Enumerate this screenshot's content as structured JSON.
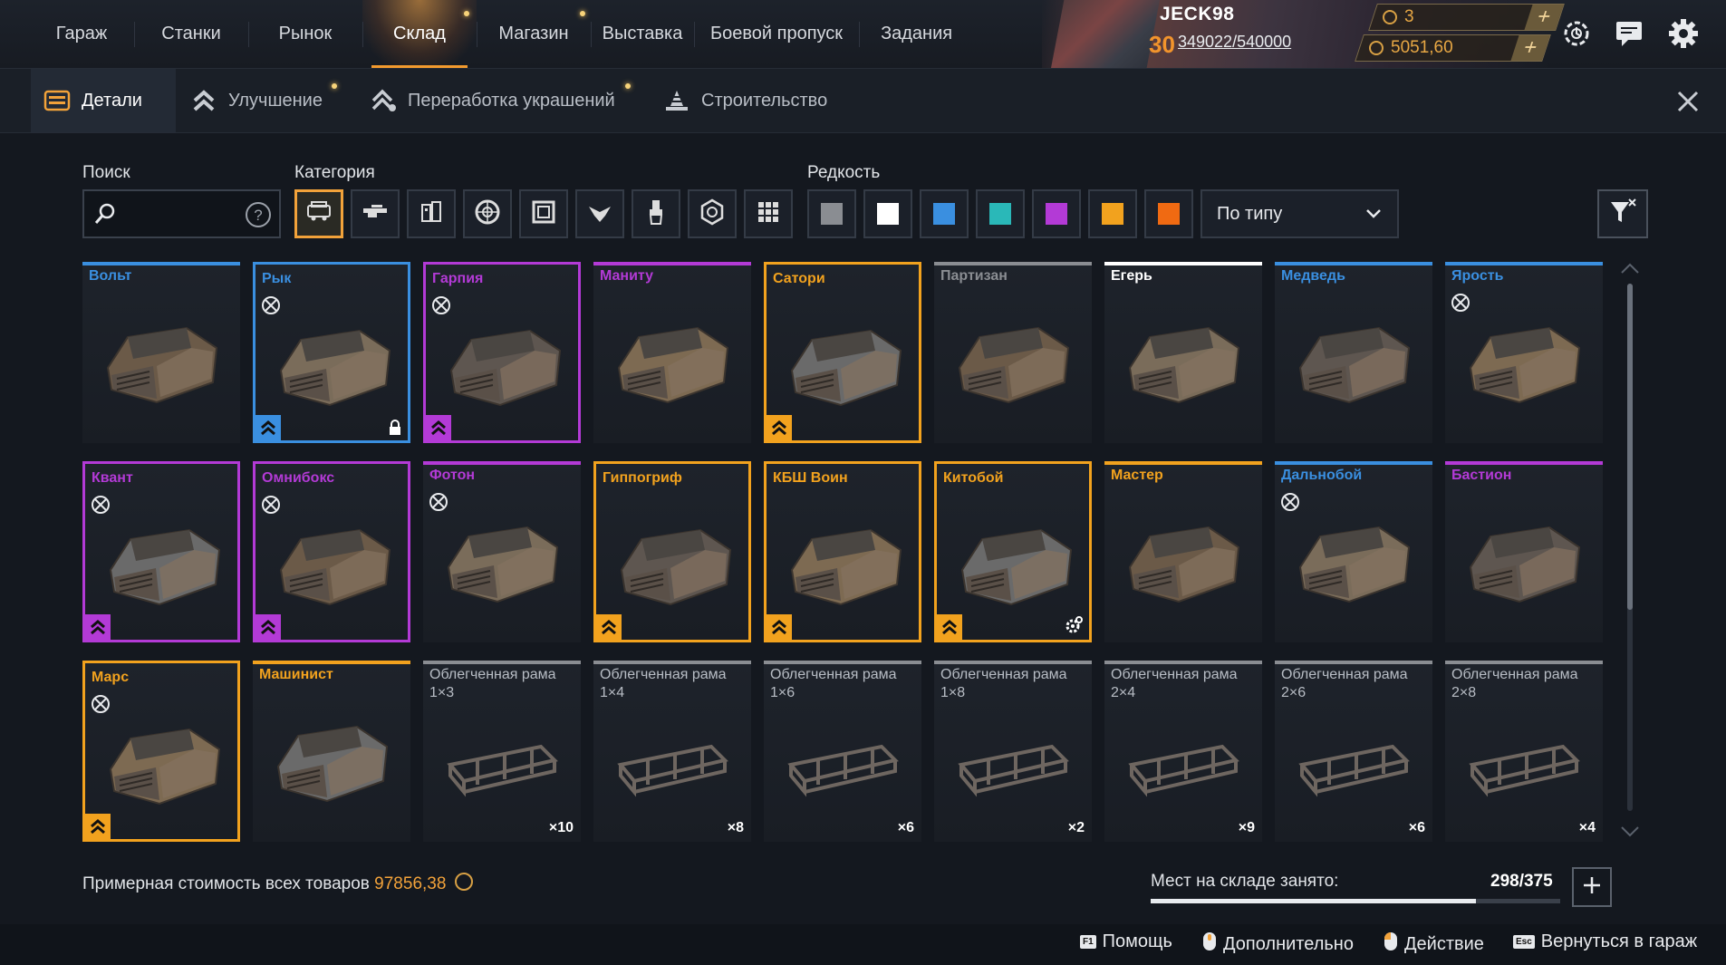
{
  "topnav": {
    "items": [
      "Гараж",
      "Станки",
      "Рынок",
      "Склад",
      "Магазин",
      "Выставка",
      "Боевой пропуск",
      "Задания"
    ],
    "active_index": 3
  },
  "profile": {
    "name": "JECK98",
    "level": "30",
    "xp": "349022/540000",
    "currency1": "3",
    "currency2": "5051,60"
  },
  "subnav": {
    "tabs": [
      "Детали",
      "Улучшение",
      "Переработка украшений",
      "Строительство"
    ],
    "active_index": 0
  },
  "filters": {
    "search_label": "Поиск",
    "search_placeholder": "",
    "category_label": "Категория",
    "rarity_label": "Редкость",
    "category_icons": [
      "cabin-icon",
      "weapon-icon",
      "module-icon",
      "wheel-icon",
      "frame-icon",
      "decor-icon",
      "paint-icon",
      "hex-nut-icon",
      "all-grid-icon"
    ],
    "rarity_colors": [
      "#8a8d92",
      "#ffffff",
      "#3a8fe0",
      "#2ab8b8",
      "#b33ad6",
      "#f2a21e",
      "#f06a12"
    ],
    "sort_value": "По типу"
  },
  "colors": {
    "common": "#8a8d92",
    "special": "#ffffff",
    "rare": "#3a8fe0",
    "epic": "#b33ad6",
    "legendary": "#f2a21e"
  },
  "items": [
    {
      "name": "Вольт",
      "rarity": "rare",
      "framed": false,
      "no_trade": false,
      "tier": false,
      "lock": false,
      "gear": false,
      "qty": ""
    },
    {
      "name": "Рык",
      "rarity": "rare",
      "framed": true,
      "no_trade": true,
      "tier": true,
      "lock": true,
      "gear": false,
      "qty": ""
    },
    {
      "name": "Гарпия",
      "rarity": "epic",
      "framed": true,
      "no_trade": true,
      "tier": true,
      "lock": false,
      "gear": false,
      "qty": ""
    },
    {
      "name": "Маниту",
      "rarity": "epic",
      "framed": false,
      "no_trade": false,
      "tier": false,
      "lock": false,
      "gear": false,
      "qty": ""
    },
    {
      "name": "Сатори",
      "rarity": "legendary",
      "framed": true,
      "no_trade": false,
      "tier": true,
      "lock": false,
      "gear": false,
      "qty": ""
    },
    {
      "name": "Партизан",
      "rarity": "common",
      "framed": false,
      "no_trade": false,
      "tier": false,
      "lock": false,
      "gear": false,
      "qty": ""
    },
    {
      "name": "Егерь",
      "rarity": "special",
      "framed": false,
      "no_trade": false,
      "tier": false,
      "lock": false,
      "gear": false,
      "qty": ""
    },
    {
      "name": "Медведь",
      "rarity": "rare",
      "framed": false,
      "no_trade": false,
      "tier": false,
      "lock": false,
      "gear": false,
      "qty": ""
    },
    {
      "name": "Ярость",
      "rarity": "rare",
      "framed": false,
      "no_trade": true,
      "tier": false,
      "lock": false,
      "gear": false,
      "qty": ""
    },
    {
      "name": "Квант",
      "rarity": "epic",
      "framed": true,
      "no_trade": true,
      "tier": true,
      "lock": false,
      "gear": false,
      "qty": ""
    },
    {
      "name": "Омнибокс",
      "rarity": "epic",
      "framed": true,
      "no_trade": true,
      "tier": true,
      "lock": false,
      "gear": false,
      "qty": ""
    },
    {
      "name": "Фотон",
      "rarity": "epic",
      "framed": false,
      "no_trade": true,
      "tier": false,
      "lock": false,
      "gear": false,
      "qty": ""
    },
    {
      "name": "Гиппогриф",
      "rarity": "legendary",
      "framed": true,
      "no_trade": false,
      "tier": true,
      "lock": false,
      "gear": false,
      "qty": ""
    },
    {
      "name": "КБШ Воин",
      "rarity": "legendary",
      "framed": true,
      "no_trade": false,
      "tier": true,
      "lock": false,
      "gear": false,
      "qty": ""
    },
    {
      "name": "Китобой",
      "rarity": "legendary",
      "framed": true,
      "no_trade": false,
      "tier": true,
      "lock": false,
      "gear": true,
      "qty": ""
    },
    {
      "name": "Мастер",
      "rarity": "legendary",
      "framed": false,
      "no_trade": false,
      "tier": false,
      "lock": false,
      "gear": false,
      "qty": ""
    },
    {
      "name": "Дальнобой",
      "rarity": "rare",
      "framed": false,
      "no_trade": true,
      "tier": false,
      "lock": false,
      "gear": false,
      "qty": ""
    },
    {
      "name": "Бастион",
      "rarity": "epic",
      "framed": false,
      "no_trade": false,
      "tier": false,
      "lock": false,
      "gear": false,
      "qty": ""
    },
    {
      "name": "Марс",
      "rarity": "legendary",
      "framed": true,
      "no_trade": true,
      "tier": true,
      "lock": false,
      "gear": false,
      "qty": ""
    },
    {
      "name": "Машинист",
      "rarity": "legendary",
      "framed": false,
      "no_trade": false,
      "tier": false,
      "lock": false,
      "gear": false,
      "qty": ""
    },
    {
      "name": "Облегченная рама 1×3",
      "rarity": "common",
      "framed": false,
      "no_trade": false,
      "tier": false,
      "lock": false,
      "gear": false,
      "qty": "×10"
    },
    {
      "name": "Облегченная рама 1×4",
      "rarity": "common",
      "framed": false,
      "no_trade": false,
      "tier": false,
      "lock": false,
      "gear": false,
      "qty": "×8"
    },
    {
      "name": "Облегченная рама 1×6",
      "rarity": "common",
      "framed": false,
      "no_trade": false,
      "tier": false,
      "lock": false,
      "gear": false,
      "qty": "×6"
    },
    {
      "name": "Облегченная рама 1×8",
      "rarity": "common",
      "framed": false,
      "no_trade": false,
      "tier": false,
      "lock": false,
      "gear": false,
      "qty": "×2"
    },
    {
      "name": "Облегченная рама 2×4",
      "rarity": "common",
      "framed": false,
      "no_trade": false,
      "tier": false,
      "lock": false,
      "gear": false,
      "qty": "×9"
    },
    {
      "name": "Облегченная рама 2×6",
      "rarity": "common",
      "framed": false,
      "no_trade": false,
      "tier": false,
      "lock": false,
      "gear": false,
      "qty": "×6"
    },
    {
      "name": "Облегченная рама 2×8",
      "rarity": "common",
      "framed": false,
      "no_trade": false,
      "tier": false,
      "lock": false,
      "gear": false,
      "qty": "×4"
    }
  ],
  "footer": {
    "value_label": "Примерная стоимость всех товаров",
    "value": "97856,38",
    "capacity_label": "Мест на складе занято:",
    "capacity": "298/375",
    "capacity_fraction": 0.795
  },
  "hints": [
    {
      "key": "F1",
      "label": "Помощь"
    },
    {
      "key": "mouse-middle-icon",
      "label": "Дополнительно"
    },
    {
      "key": "mouse-left-icon",
      "label": "Действие"
    },
    {
      "key": "Esc",
      "label": "Вернуться в гараж"
    }
  ]
}
